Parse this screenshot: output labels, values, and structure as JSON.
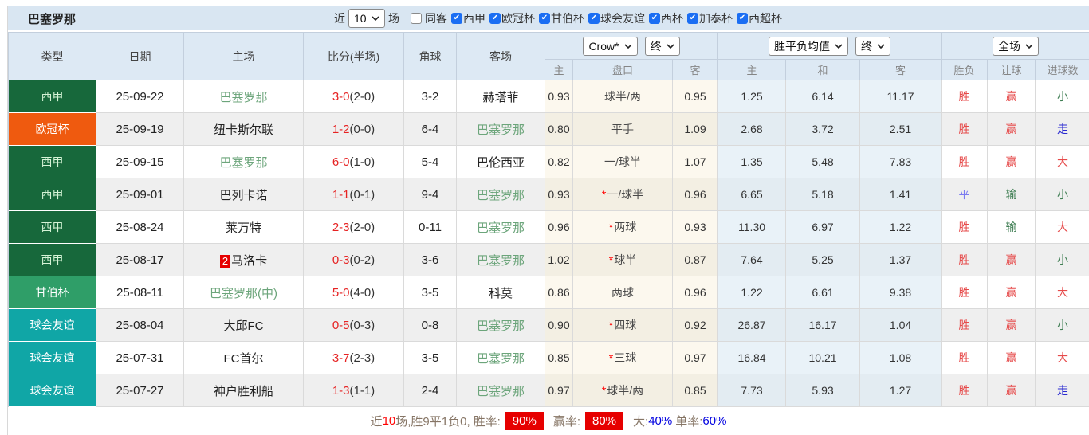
{
  "colors": {
    "liga": "#17683b",
    "ucl": "#ef5a0f",
    "gamper": "#2f9e68",
    "friendly": "#10a6a6",
    "liga_text": "#d5f3d6",
    "cup_text": "#ffffff",
    "accent_red": "#e60000",
    "res_red": "#e64a4a",
    "res_softblue": "#7b7bf0",
    "res_green": "#3f7e53",
    "res_blue": "#2a2ad0",
    "team_green": "#6ca57b",
    "score_red": "#e62222",
    "link_blue": "#0000e0"
  },
  "topbar": {
    "team": "巴塞罗那",
    "recent_label": "近",
    "recent_value": "10",
    "matches_label": "场",
    "same_away_label": "同客",
    "same_away_checked": false,
    "filters": [
      {
        "label": "西甲",
        "checked": true
      },
      {
        "label": "欧冠杯",
        "checked": true
      },
      {
        "label": "甘伯杯",
        "checked": true
      },
      {
        "label": "球会友谊",
        "checked": true
      },
      {
        "label": "西杯",
        "checked": true
      },
      {
        "label": "加泰杯",
        "checked": true
      },
      {
        "label": "西超杯",
        "checked": true
      }
    ]
  },
  "table": {
    "main_headers": [
      "类型",
      "日期",
      "主场",
      "比分(半场)",
      "角球",
      "客场"
    ],
    "selects": {
      "company": "Crow*",
      "time1": "终",
      "avg": "胜平负均值",
      "time2": "终",
      "scope": "全场"
    },
    "subheaders": [
      "主",
      "盘口",
      "客",
      "主",
      "和",
      "客",
      "胜负",
      "让球",
      "进球数"
    ],
    "type_color_map": {
      "西甲": "liga",
      "欧冠杯": "ucl",
      "甘伯杯": "gamper",
      "球会友谊": "friendly"
    },
    "type_text_map": {
      "西甲": "liga_text",
      "欧冠杯": "cup_text",
      "甘伯杯": "cup_text",
      "球会友谊": "cup_text"
    },
    "rows": [
      {
        "type": "西甲",
        "date": "25-09-22",
        "home": {
          "name": "巴塞罗那",
          "green": true,
          "badge": ""
        },
        "score": "3-0",
        "half": "(2-0)",
        "corners": "3-2",
        "away": {
          "name": "赫塔菲",
          "green": false
        },
        "odds_home": "0.93",
        "star": false,
        "handicap": "球半/两",
        "odds_away": "0.95",
        "avg_home": "1.25",
        "avg_draw": "6.14",
        "avg_away": "11.17",
        "result": {
          "t": "胜",
          "c": "red"
        },
        "hresult": {
          "t": "赢",
          "c": "red"
        },
        "goals": {
          "t": "小",
          "c": "green"
        }
      },
      {
        "type": "欧冠杯",
        "date": "25-09-19",
        "home": {
          "name": "纽卡斯尔联",
          "green": false,
          "badge": ""
        },
        "score": "1-2",
        "half": "(0-0)",
        "corners": "6-4",
        "away": {
          "name": "巴塞罗那",
          "green": true
        },
        "odds_home": "0.80",
        "star": false,
        "handicap": "平手",
        "odds_away": "1.09",
        "avg_home": "2.68",
        "avg_draw": "3.72",
        "avg_away": "2.51",
        "result": {
          "t": "胜",
          "c": "red"
        },
        "hresult": {
          "t": "赢",
          "c": "red"
        },
        "goals": {
          "t": "走",
          "c": "blue"
        }
      },
      {
        "type": "西甲",
        "date": "25-09-15",
        "home": {
          "name": "巴塞罗那",
          "green": true,
          "badge": ""
        },
        "score": "6-0",
        "half": "(1-0)",
        "corners": "5-4",
        "away": {
          "name": "巴伦西亚",
          "green": false
        },
        "odds_home": "0.82",
        "star": false,
        "handicap": "一/球半",
        "odds_away": "1.07",
        "avg_home": "1.35",
        "avg_draw": "5.48",
        "avg_away": "7.83",
        "result": {
          "t": "胜",
          "c": "red"
        },
        "hresult": {
          "t": "赢",
          "c": "red"
        },
        "goals": {
          "t": "大",
          "c": "red"
        }
      },
      {
        "type": "西甲",
        "date": "25-09-01",
        "home": {
          "name": "巴列卡诺",
          "green": false,
          "badge": ""
        },
        "score": "1-1",
        "half": "(0-1)",
        "corners": "9-4",
        "away": {
          "name": "巴塞罗那",
          "green": true
        },
        "odds_home": "0.93",
        "star": true,
        "handicap": "一/球半",
        "odds_away": "0.96",
        "avg_home": "6.65",
        "avg_draw": "5.18",
        "avg_away": "1.41",
        "result": {
          "t": "平",
          "c": "softblue"
        },
        "hresult": {
          "t": "输",
          "c": "green"
        },
        "goals": {
          "t": "小",
          "c": "green"
        }
      },
      {
        "type": "西甲",
        "date": "25-08-24",
        "home": {
          "name": "莱万特",
          "green": false,
          "badge": ""
        },
        "score": "2-3",
        "half": "(2-0)",
        "corners": "0-11",
        "away": {
          "name": "巴塞罗那",
          "green": true
        },
        "odds_home": "0.96",
        "star": true,
        "handicap": "两球",
        "odds_away": "0.93",
        "avg_home": "11.30",
        "avg_draw": "6.97",
        "avg_away": "1.22",
        "result": {
          "t": "胜",
          "c": "red"
        },
        "hresult": {
          "t": "输",
          "c": "green"
        },
        "goals": {
          "t": "大",
          "c": "red"
        }
      },
      {
        "type": "西甲",
        "date": "25-08-17",
        "home": {
          "name": "马洛卡",
          "green": false,
          "badge": "2"
        },
        "score": "0-3",
        "half": "(0-2)",
        "corners": "3-6",
        "away": {
          "name": "巴塞罗那",
          "green": true
        },
        "odds_home": "1.02",
        "star": true,
        "handicap": "球半",
        "odds_away": "0.87",
        "avg_home": "7.64",
        "avg_draw": "5.25",
        "avg_away": "1.37",
        "result": {
          "t": "胜",
          "c": "red"
        },
        "hresult": {
          "t": "赢",
          "c": "red"
        },
        "goals": {
          "t": "小",
          "c": "green"
        }
      },
      {
        "type": "甘伯杯",
        "date": "25-08-11",
        "home": {
          "name": "巴塞罗那(中)",
          "green": true,
          "badge": ""
        },
        "score": "5-0",
        "half": "(4-0)",
        "corners": "3-5",
        "away": {
          "name": "科莫",
          "green": false
        },
        "odds_home": "0.86",
        "star": false,
        "handicap": "两球",
        "odds_away": "0.96",
        "avg_home": "1.22",
        "avg_draw": "6.61",
        "avg_away": "9.38",
        "result": {
          "t": "胜",
          "c": "red"
        },
        "hresult": {
          "t": "赢",
          "c": "red"
        },
        "goals": {
          "t": "大",
          "c": "red"
        }
      },
      {
        "type": "球会友谊",
        "date": "25-08-04",
        "home": {
          "name": "大邱FC",
          "green": false,
          "badge": ""
        },
        "score": "0-5",
        "half": "(0-3)",
        "corners": "0-8",
        "away": {
          "name": "巴塞罗那",
          "green": true
        },
        "odds_home": "0.90",
        "star": true,
        "handicap": "四球",
        "odds_away": "0.92",
        "avg_home": "26.87",
        "avg_draw": "16.17",
        "avg_away": "1.04",
        "result": {
          "t": "胜",
          "c": "red"
        },
        "hresult": {
          "t": "赢",
          "c": "red"
        },
        "goals": {
          "t": "小",
          "c": "green"
        }
      },
      {
        "type": "球会友谊",
        "date": "25-07-31",
        "home": {
          "name": "FC首尔",
          "green": false,
          "badge": ""
        },
        "score": "3-7",
        "half": "(2-3)",
        "corners": "3-5",
        "away": {
          "name": "巴塞罗那",
          "green": true
        },
        "odds_home": "0.85",
        "star": true,
        "handicap": "三球",
        "odds_away": "0.97",
        "avg_home": "16.84",
        "avg_draw": "10.21",
        "avg_away": "1.08",
        "result": {
          "t": "胜",
          "c": "red"
        },
        "hresult": {
          "t": "赢",
          "c": "red"
        },
        "goals": {
          "t": "大",
          "c": "red"
        }
      },
      {
        "type": "球会友谊",
        "date": "25-07-27",
        "home": {
          "name": "神户胜利船",
          "green": false,
          "badge": ""
        },
        "score": "1-3",
        "half": "(1-1)",
        "corners": "2-4",
        "away": {
          "name": "巴塞罗那",
          "green": true
        },
        "odds_home": "0.97",
        "star": true,
        "handicap": "球半/两",
        "odds_away": "0.85",
        "avg_home": "7.73",
        "avg_draw": "5.93",
        "avg_away": "1.27",
        "result": {
          "t": "胜",
          "c": "red"
        },
        "hresult": {
          "t": "赢",
          "c": "red"
        },
        "goals": {
          "t": "走",
          "c": "blue"
        }
      }
    ]
  },
  "summary": {
    "prefix": "近",
    "recent_count": "10",
    "record": "场,胜9平1负0,",
    "win_rate_label": "胜率:",
    "win_rate": "90%",
    "handicap_label": "赢率:",
    "handicap_rate": "80%",
    "over_label": "大:",
    "over_rate": "40%",
    "single_label": "单率:",
    "single_rate": "60%"
  }
}
